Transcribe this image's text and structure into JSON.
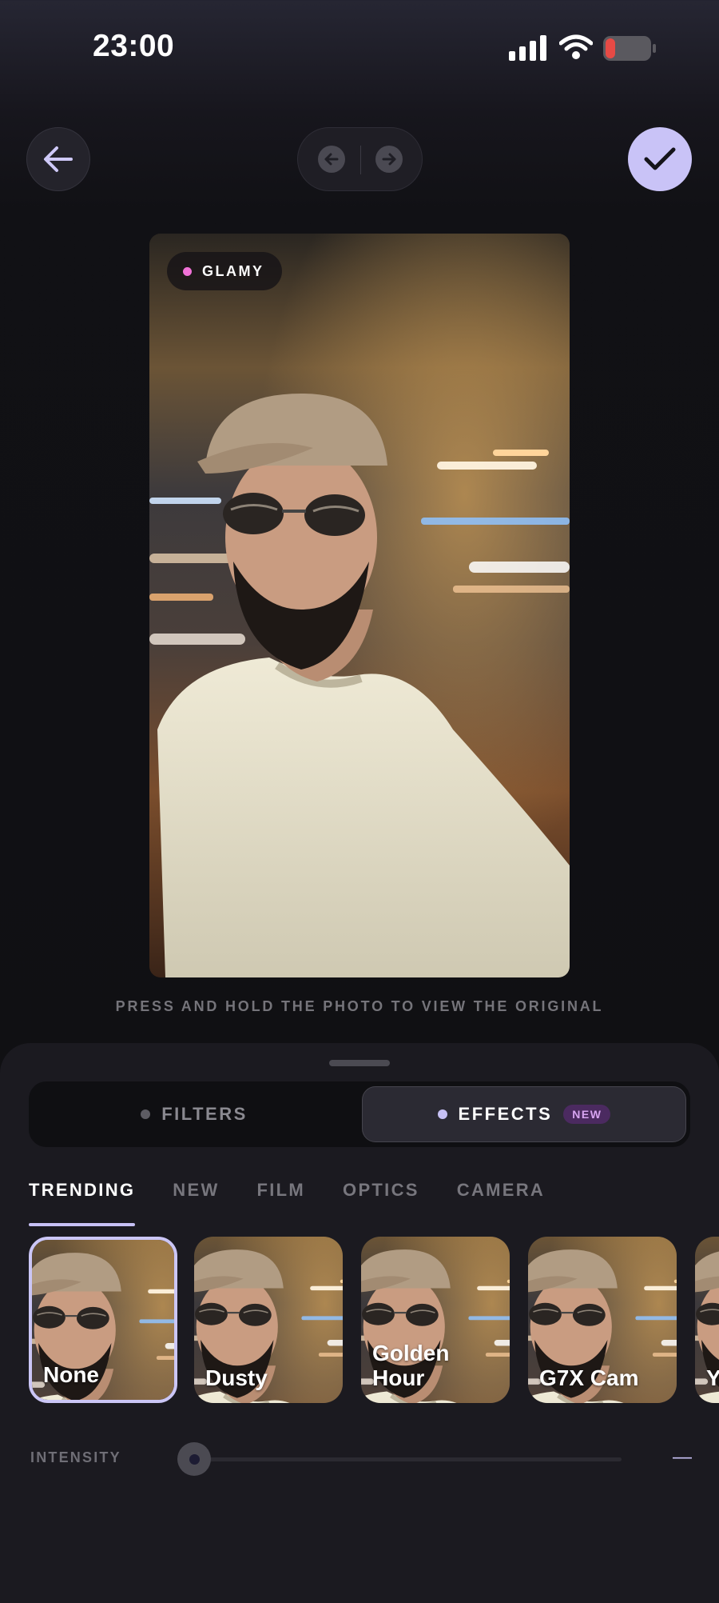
{
  "status_bar": {
    "time": "23:00",
    "battery_color": "#e64a45"
  },
  "photo": {
    "badge": "GLAMY",
    "badge_dot_color": "#f071d6"
  },
  "hint": "PRESS AND HOLD THE PHOTO TO VIEW THE ORIGINAL",
  "segments": {
    "filters": "FILTERS",
    "effects": "EFFECTS",
    "effects_badge": "NEW",
    "selected": "effects"
  },
  "tabs": [
    {
      "label": "TRENDING",
      "active": true
    },
    {
      "label": "NEW",
      "active": false
    },
    {
      "label": "FILM",
      "active": false
    },
    {
      "label": "OPTICS",
      "active": false
    },
    {
      "label": "CAMERA",
      "active": false
    }
  ],
  "effects": [
    {
      "label": "None",
      "selected": true
    },
    {
      "label": "Dusty",
      "selected": false
    },
    {
      "label": "Golden Hour",
      "selected": false
    },
    {
      "label": "G7X Cam",
      "selected": false
    },
    {
      "label": "Y",
      "selected": false
    }
  ],
  "intensity": {
    "label": "INTENSITY",
    "value_text": "—",
    "level": 0
  },
  "accent_color": "#c9c3f7"
}
